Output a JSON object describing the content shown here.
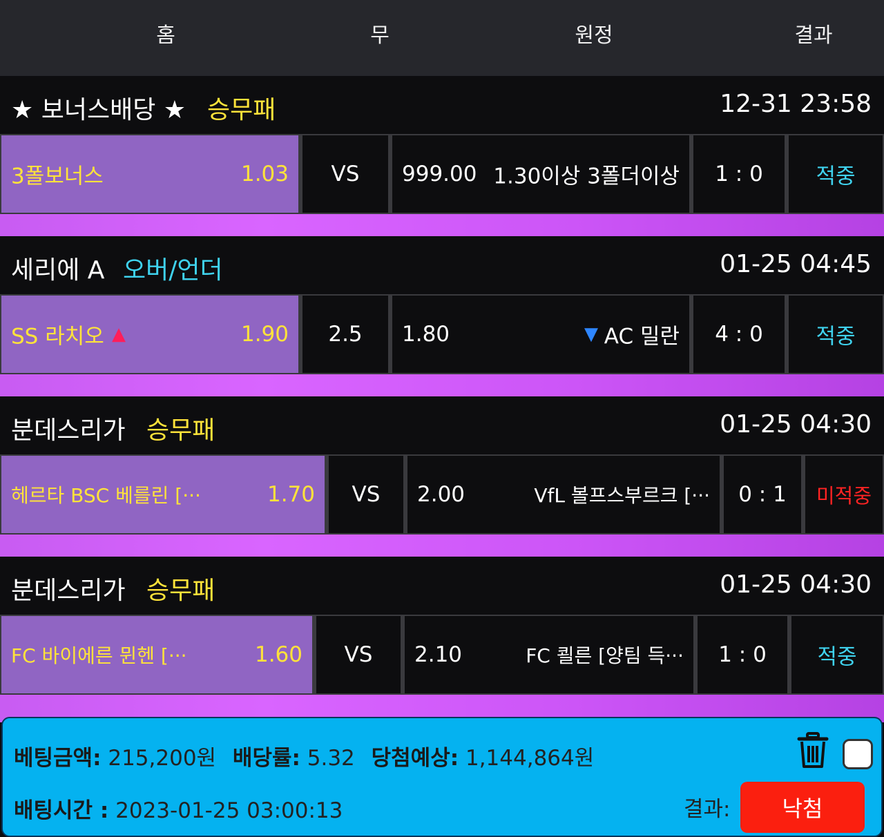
{
  "header": {
    "home": "홈",
    "draw": "무",
    "away": "원정",
    "result": "결과"
  },
  "leagues": [
    {
      "name": "★ 보너스배당 ★",
      "type": "승무패",
      "time": "12-31 23:58"
    },
    {
      "name": "세리에 A",
      "type": "오버/언더",
      "time": "01-25 04:45"
    },
    {
      "name": "분데스리가",
      "type": "승무패",
      "time": "01-25 04:30"
    },
    {
      "name": "분데스리가",
      "type": "승무패",
      "time": "01-25 04:30"
    }
  ],
  "games": [
    {
      "home_team": "3폴보너스",
      "home_odds": "1.03",
      "mid": "VS",
      "away_odds": "999.00",
      "away_team": "1.30이상 3폴더이상",
      "score": "1 : 0",
      "status": "적중"
    },
    {
      "home_team": "SS 라치오",
      "home_arrow": "▲",
      "home_odds": "1.90",
      "mid": "2.5",
      "away_odds": "1.80",
      "away_arrow": "▼",
      "away_team": "AC 밀란",
      "score": "4 : 0",
      "status": "적중"
    },
    {
      "home_team": "헤르타 BSC 베를린 [···",
      "home_odds": "1.70",
      "mid": "VS",
      "away_odds": "2.00",
      "away_team": "VfL 볼프스부르크 [···",
      "score": "0 : 1",
      "status": "미적중"
    },
    {
      "home_team": "FC 바이에른 뮌헨 [···",
      "home_odds": "1.60",
      "mid": "VS",
      "away_odds": "2.10",
      "away_team": "FC 쾰른 [양팀 득···",
      "score": "1 : 0",
      "status": "적중"
    }
  ],
  "summary": {
    "bet_amount_label": "베팅금액:",
    "bet_amount": "215,200원",
    "odds_label": "배당률:",
    "odds": "5.32",
    "expected_label": "당첨예상:",
    "expected": "1,144,864원",
    "time_label": "배팅시간 :",
    "time": "2023-01-25 03:00:13",
    "result_label": "결과:",
    "result_button": "낙첨"
  },
  "icons": {
    "delete": "trash-icon",
    "select": "checkbox"
  },
  "colors": {
    "home_cell": "#9065c3",
    "band": "#d965ff",
    "hit": "#3fd2ee",
    "miss": "#ff2323",
    "market_win_draw_lose": "#ffe33a",
    "market_over_under": "#3fd2ee",
    "panel": "#05b2f0",
    "lose_button": "#fb1f0f"
  }
}
